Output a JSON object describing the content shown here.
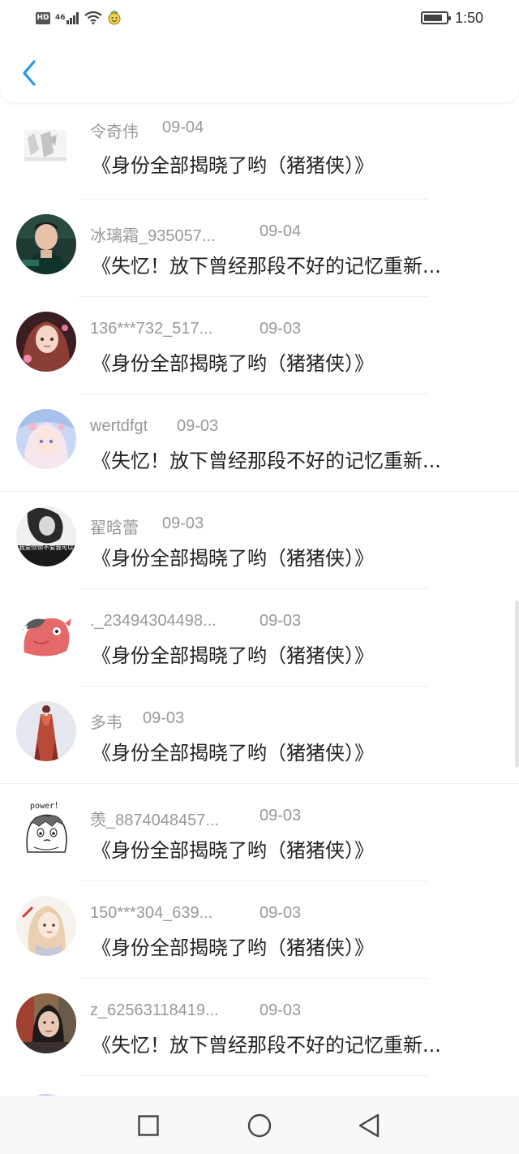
{
  "status_bar": {
    "hd": "HD",
    "network": "46",
    "time": "1:50"
  },
  "nav": {
    "back_icon": "chevron-left-icon",
    "accent": "#2196F3"
  },
  "items": [
    {
      "user": "令奇伟",
      "date": "09-04",
      "title": "《身份全部揭晓了哟（猪猪侠）》"
    },
    {
      "user": "冰璃霜_935057...",
      "date": "09-04",
      "title": "《失忆！放下曾经那段不好的记忆重新..."
    },
    {
      "user": "136***732_517...",
      "date": "09-03",
      "title": "《身份全部揭晓了哟（猪猪侠）》"
    },
    {
      "user": "wertdfgt",
      "date": "09-03",
      "title": "《失忆！放下曾经那段不好的记忆重新..."
    },
    {
      "user": "翟晗蕾",
      "date": "09-03",
      "title": "《身份全部揭晓了哟（猪猪侠）》",
      "avatar_caption": "我爱你你不爱我可以"
    },
    {
      "user": "._23494304498...",
      "date": "09-03",
      "title": "《身份全部揭晓了哟（猪猪侠）》"
    },
    {
      "user": "多韦",
      "date": "09-03",
      "title": "《身份全部揭晓了哟（猪猪侠）》"
    },
    {
      "user": "羡_8874048457...",
      "date": "09-03",
      "title": "《身份全部揭晓了哟（猪猪侠）》",
      "avatar_caption": "power！"
    },
    {
      "user": "150***304_639...",
      "date": "09-03",
      "title": "《身份全部揭晓了哟（猪猪侠）》"
    },
    {
      "user": "z_62563118419...",
      "date": "09-03",
      "title": "《失忆！放下曾经那段不好的记忆重新..."
    }
  ],
  "system_nav": {
    "recents_icon": "square-icon",
    "home_icon": "circle-icon",
    "back_icon": "triangle-back-icon"
  }
}
